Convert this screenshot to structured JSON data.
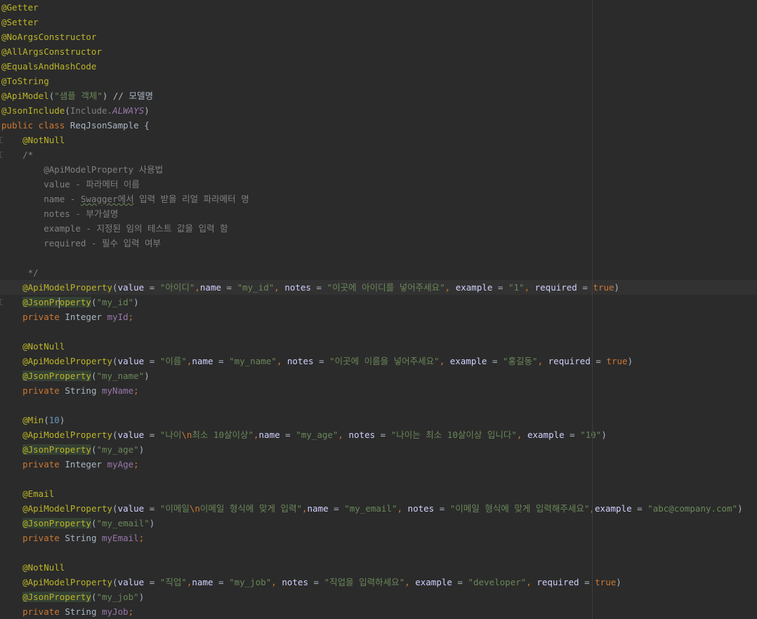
{
  "editor": {
    "language": "java",
    "current_line": 20,
    "theme_colors": {
      "background": "#2b2b2b",
      "annotation": "#bbb529",
      "keyword": "#cc7832",
      "string": "#6a8759",
      "comment": "#808080",
      "field": "#9876aa",
      "number": "#6897bb",
      "parameter": "#d0d0ff",
      "text": "#a9b7c6"
    },
    "lines": [
      {
        "tokens": [
          {
            "t": "ann",
            "v": "@Getter"
          }
        ]
      },
      {
        "tokens": [
          {
            "t": "ann",
            "v": "@Setter"
          }
        ]
      },
      {
        "tokens": [
          {
            "t": "ann",
            "v": "@NoArgsConstructor"
          }
        ]
      },
      {
        "tokens": [
          {
            "t": "ann",
            "v": "@AllArgsConstructor"
          }
        ]
      },
      {
        "tokens": [
          {
            "t": "ann",
            "v": "@EqualsAndHashCode"
          }
        ]
      },
      {
        "tokens": [
          {
            "t": "ann",
            "v": "@ToString"
          }
        ]
      },
      {
        "tokens": [
          {
            "t": "ann",
            "v": "@ApiModel"
          },
          {
            "t": "plain",
            "v": "("
          },
          {
            "t": "str",
            "v": "\"샘플 객체\""
          },
          {
            "t": "plain",
            "v": ") // 모델명"
          }
        ]
      },
      {
        "tokens": [
          {
            "t": "ann",
            "v": "@JsonInclude"
          },
          {
            "t": "plain",
            "v": "("
          },
          {
            "t": "gray",
            "v": "Include."
          },
          {
            "t": "field-it",
            "v": "ALWAYS"
          },
          {
            "t": "plain",
            "v": ")"
          }
        ]
      },
      {
        "tokens": [
          {
            "t": "kw",
            "v": "public class "
          },
          {
            "t": "plain",
            "v": "ReqJsonSample {"
          }
        ]
      },
      {
        "gutter": true,
        "tokens": [
          {
            "t": "plain",
            "v": "    "
          },
          {
            "t": "ann",
            "v": "@NotNull"
          }
        ]
      },
      {
        "gutter": true,
        "tokens": [
          {
            "t": "cmt",
            "v": "    /*"
          }
        ]
      },
      {
        "tokens": [
          {
            "t": "cmt",
            "v": "        @ApiModelProperty 사용법"
          }
        ]
      },
      {
        "tokens": [
          {
            "t": "cmt",
            "v": "        value - 파라메터 이름"
          }
        ]
      },
      {
        "tokens": [
          {
            "t": "cmt",
            "v": "        name - "
          },
          {
            "t": "cmt-typo",
            "v": "Swagger에서"
          },
          {
            "t": "cmt",
            "v": " 입력 받을 리얼 파라메터 명"
          }
        ]
      },
      {
        "tokens": [
          {
            "t": "cmt",
            "v": "        notes - 부가설명"
          }
        ]
      },
      {
        "tokens": [
          {
            "t": "cmt",
            "v": "        example - 지정된 임의 테스트 값을 입력 함"
          }
        ]
      },
      {
        "tokens": [
          {
            "t": "cmt",
            "v": "        required - 필수 입력 여부"
          }
        ]
      },
      {
        "tokens": []
      },
      {
        "tokens": [
          {
            "t": "cmt",
            "v": "     */"
          }
        ]
      },
      {
        "tokens": [
          {
            "t": "plain",
            "v": "    "
          },
          {
            "t": "ann",
            "v": "@ApiModelProperty"
          },
          {
            "t": "plain",
            "v": "("
          },
          {
            "t": "param",
            "v": "value"
          },
          {
            "t": "plain",
            "v": " = "
          },
          {
            "t": "str",
            "v": "\"아이디\""
          },
          {
            "t": "kw",
            "v": ","
          },
          {
            "t": "param",
            "v": "name"
          },
          {
            "t": "plain",
            "v": " = "
          },
          {
            "t": "str",
            "v": "\"my_id\""
          },
          {
            "t": "kw",
            "v": ", "
          },
          {
            "t": "param",
            "v": "notes"
          },
          {
            "t": "plain",
            "v": " = "
          },
          {
            "t": "str",
            "v": "\"이곳에 아이디를 넣어주세요\""
          },
          {
            "t": "kw",
            "v": ", "
          },
          {
            "t": "param",
            "v": "example"
          },
          {
            "t": "plain",
            "v": " = "
          },
          {
            "t": "str",
            "v": "\"1\""
          },
          {
            "t": "kw",
            "v": ", "
          },
          {
            "t": "param",
            "v": "required"
          },
          {
            "t": "plain",
            "v": " = "
          },
          {
            "t": "kw",
            "v": "true"
          },
          {
            "t": "plain",
            "v": ")"
          }
        ]
      },
      {
        "gutter": true,
        "caret": true,
        "tokens": [
          {
            "t": "plain",
            "v": "    "
          },
          {
            "t": "ann-bg",
            "v": "@JsonPr"
          },
          {
            "t": "caret",
            "v": ""
          },
          {
            "t": "ann-bg",
            "v": "operty"
          },
          {
            "t": "plain",
            "v": "("
          },
          {
            "t": "str",
            "v": "\"my_id\""
          },
          {
            "t": "plain",
            "v": ")"
          }
        ]
      },
      {
        "tokens": [
          {
            "t": "kw",
            "v": "    private "
          },
          {
            "t": "plain",
            "v": "Integer "
          },
          {
            "t": "field",
            "v": "myId"
          },
          {
            "t": "kw",
            "v": ";"
          }
        ]
      },
      {
        "tokens": []
      },
      {
        "tokens": [
          {
            "t": "plain",
            "v": "    "
          },
          {
            "t": "ann",
            "v": "@NotNull"
          }
        ]
      },
      {
        "tokens": [
          {
            "t": "plain",
            "v": "    "
          },
          {
            "t": "ann",
            "v": "@ApiModelProperty"
          },
          {
            "t": "plain",
            "v": "("
          },
          {
            "t": "param",
            "v": "value"
          },
          {
            "t": "plain",
            "v": " = "
          },
          {
            "t": "str",
            "v": "\"이름\""
          },
          {
            "t": "kw",
            "v": ","
          },
          {
            "t": "param",
            "v": "name"
          },
          {
            "t": "plain",
            "v": " = "
          },
          {
            "t": "str",
            "v": "\"my_name\""
          },
          {
            "t": "kw",
            "v": ", "
          },
          {
            "t": "param",
            "v": "notes"
          },
          {
            "t": "plain",
            "v": " = "
          },
          {
            "t": "str",
            "v": "\"이곳에 이름을 넣어주세요\""
          },
          {
            "t": "kw",
            "v": ", "
          },
          {
            "t": "param",
            "v": "example"
          },
          {
            "t": "plain",
            "v": " = "
          },
          {
            "t": "str",
            "v": "\"홍길동\""
          },
          {
            "t": "kw",
            "v": ", "
          },
          {
            "t": "param",
            "v": "required"
          },
          {
            "t": "plain",
            "v": " = "
          },
          {
            "t": "kw",
            "v": "true"
          },
          {
            "t": "plain",
            "v": ")"
          }
        ]
      },
      {
        "tokens": [
          {
            "t": "plain",
            "v": "    "
          },
          {
            "t": "ann-bg",
            "v": "@JsonProperty"
          },
          {
            "t": "plain",
            "v": "("
          },
          {
            "t": "str",
            "v": "\"my_name\""
          },
          {
            "t": "plain",
            "v": ")"
          }
        ]
      },
      {
        "tokens": [
          {
            "t": "kw",
            "v": "    private "
          },
          {
            "t": "plain",
            "v": "String "
          },
          {
            "t": "field",
            "v": "myName"
          },
          {
            "t": "kw",
            "v": ";"
          }
        ]
      },
      {
        "tokens": []
      },
      {
        "tokens": [
          {
            "t": "plain",
            "v": "    "
          },
          {
            "t": "ann",
            "v": "@Min"
          },
          {
            "t": "plain",
            "v": "("
          },
          {
            "t": "num",
            "v": "10"
          },
          {
            "t": "plain",
            "v": ")"
          }
        ]
      },
      {
        "tokens": [
          {
            "t": "plain",
            "v": "    "
          },
          {
            "t": "ann",
            "v": "@ApiModelProperty"
          },
          {
            "t": "plain",
            "v": "("
          },
          {
            "t": "param",
            "v": "value"
          },
          {
            "t": "plain",
            "v": " = "
          },
          {
            "t": "str",
            "v": "\"나이"
          },
          {
            "t": "esc",
            "v": "\\n"
          },
          {
            "t": "str",
            "v": "최소 10살이상\""
          },
          {
            "t": "kw",
            "v": ","
          },
          {
            "t": "param",
            "v": "name"
          },
          {
            "t": "plain",
            "v": " = "
          },
          {
            "t": "str",
            "v": "\"my_age\""
          },
          {
            "t": "kw",
            "v": ", "
          },
          {
            "t": "param",
            "v": "notes"
          },
          {
            "t": "plain",
            "v": " = "
          },
          {
            "t": "str",
            "v": "\"나이는 최소 10살이상 입니다\""
          },
          {
            "t": "kw",
            "v": ", "
          },
          {
            "t": "param",
            "v": "example"
          },
          {
            "t": "plain",
            "v": " = "
          },
          {
            "t": "str",
            "v": "\"10\""
          },
          {
            "t": "plain",
            "v": ")"
          }
        ]
      },
      {
        "tokens": [
          {
            "t": "plain",
            "v": "    "
          },
          {
            "t": "ann-bg",
            "v": "@JsonProperty"
          },
          {
            "t": "plain",
            "v": "("
          },
          {
            "t": "str",
            "v": "\"my_age\""
          },
          {
            "t": "plain",
            "v": ")"
          }
        ]
      },
      {
        "tokens": [
          {
            "t": "kw",
            "v": "    private "
          },
          {
            "t": "plain",
            "v": "Integer "
          },
          {
            "t": "field",
            "v": "myAge"
          },
          {
            "t": "kw",
            "v": ";"
          }
        ]
      },
      {
        "tokens": []
      },
      {
        "tokens": [
          {
            "t": "plain",
            "v": "    "
          },
          {
            "t": "ann",
            "v": "@Email"
          }
        ]
      },
      {
        "tokens": [
          {
            "t": "plain",
            "v": "    "
          },
          {
            "t": "ann",
            "v": "@ApiModelProperty"
          },
          {
            "t": "plain",
            "v": "("
          },
          {
            "t": "param",
            "v": "value"
          },
          {
            "t": "plain",
            "v": " = "
          },
          {
            "t": "str",
            "v": "\"이메일"
          },
          {
            "t": "esc",
            "v": "\\n"
          },
          {
            "t": "str",
            "v": "이메일 형식에 맞게 입력\""
          },
          {
            "t": "kw",
            "v": ","
          },
          {
            "t": "param",
            "v": "name"
          },
          {
            "t": "plain",
            "v": " = "
          },
          {
            "t": "str",
            "v": "\"my_email\""
          },
          {
            "t": "kw",
            "v": ", "
          },
          {
            "t": "param",
            "v": "notes"
          },
          {
            "t": "plain",
            "v": " = "
          },
          {
            "t": "str",
            "v": "\"이메일 형식에 맞게 입력해주세요\""
          },
          {
            "t": "kw",
            "v": ","
          },
          {
            "t": "param",
            "v": "example"
          },
          {
            "t": "plain",
            "v": " = "
          },
          {
            "t": "str",
            "v": "\"abc@company.com\""
          },
          {
            "t": "plain",
            "v": ")"
          }
        ]
      },
      {
        "tokens": [
          {
            "t": "plain",
            "v": "    "
          },
          {
            "t": "ann-bg",
            "v": "@JsonProperty"
          },
          {
            "t": "plain",
            "v": "("
          },
          {
            "t": "str",
            "v": "\"my_email\""
          },
          {
            "t": "plain",
            "v": ")"
          }
        ]
      },
      {
        "tokens": [
          {
            "t": "kw",
            "v": "    private "
          },
          {
            "t": "plain",
            "v": "String "
          },
          {
            "t": "field",
            "v": "myEmail"
          },
          {
            "t": "kw",
            "v": ";"
          }
        ]
      },
      {
        "tokens": []
      },
      {
        "tokens": [
          {
            "t": "plain",
            "v": "    "
          },
          {
            "t": "ann",
            "v": "@NotNull"
          }
        ]
      },
      {
        "tokens": [
          {
            "t": "plain",
            "v": "    "
          },
          {
            "t": "ann",
            "v": "@ApiModelProperty"
          },
          {
            "t": "plain",
            "v": "("
          },
          {
            "t": "param",
            "v": "value"
          },
          {
            "t": "plain",
            "v": " = "
          },
          {
            "t": "str",
            "v": "\"직업\""
          },
          {
            "t": "kw",
            "v": ","
          },
          {
            "t": "param",
            "v": "name"
          },
          {
            "t": "plain",
            "v": " = "
          },
          {
            "t": "str",
            "v": "\"my_job\""
          },
          {
            "t": "kw",
            "v": ", "
          },
          {
            "t": "param",
            "v": "notes"
          },
          {
            "t": "plain",
            "v": " = "
          },
          {
            "t": "str",
            "v": "\"직업을 입력하세요\""
          },
          {
            "t": "kw",
            "v": ", "
          },
          {
            "t": "param",
            "v": "example"
          },
          {
            "t": "plain",
            "v": " = "
          },
          {
            "t": "str",
            "v": "\"developer\""
          },
          {
            "t": "kw",
            "v": ", "
          },
          {
            "t": "param",
            "v": "required"
          },
          {
            "t": "plain",
            "v": " = "
          },
          {
            "t": "kw",
            "v": "true"
          },
          {
            "t": "plain",
            "v": ")"
          }
        ]
      },
      {
        "tokens": [
          {
            "t": "plain",
            "v": "    "
          },
          {
            "t": "ann-bg",
            "v": "@JsonProperty"
          },
          {
            "t": "plain",
            "v": "("
          },
          {
            "t": "str",
            "v": "\"my_job\""
          },
          {
            "t": "plain",
            "v": ")"
          }
        ]
      },
      {
        "tokens": [
          {
            "t": "kw",
            "v": "    private "
          },
          {
            "t": "plain",
            "v": "String "
          },
          {
            "t": "field",
            "v": "myJob"
          },
          {
            "t": "kw",
            "v": ";"
          }
        ]
      }
    ]
  }
}
